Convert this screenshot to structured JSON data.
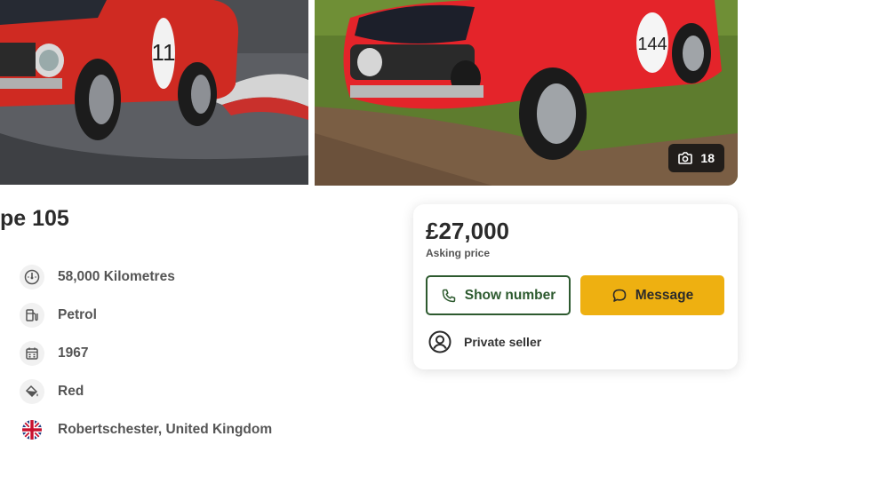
{
  "gallery": {
    "photo_count": "18",
    "left_photo": {
      "car_number": "11"
    },
    "right_photo": {
      "car_number": "144"
    }
  },
  "listing": {
    "title": "pe 105"
  },
  "specs": {
    "mileage": {
      "icon": "speedometer-icon",
      "text": "58,000 Kilometres"
    },
    "fuel": {
      "icon": "fuel-pump-icon",
      "text": "Petrol"
    },
    "year": {
      "icon": "calendar-icon",
      "text": "1967"
    },
    "colour": {
      "icon": "paint-bucket-icon",
      "text": "Red"
    },
    "location": {
      "icon": "uk-flag-icon",
      "text": "Robertschester, United Kingdom"
    }
  },
  "price_card": {
    "price": "£27,000",
    "price_label": "Asking price",
    "show_number_label": "Show number",
    "message_label": "Message",
    "seller_type": "Private seller"
  },
  "colors": {
    "accent_yellow": "#eeb011",
    "accent_green": "#2d5a2f",
    "car_red": "#d8262a"
  }
}
